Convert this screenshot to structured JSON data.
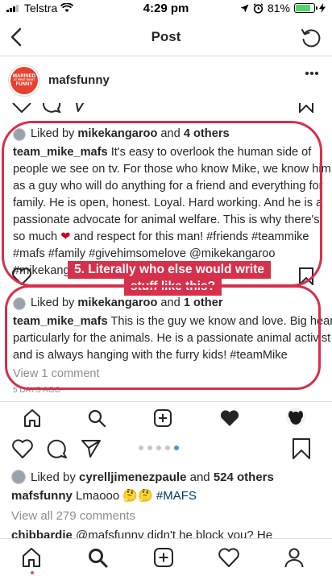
{
  "status_bar": {
    "carrier": "Telstra",
    "time": "4:29 pm",
    "battery": "81%",
    "battery_level": 0.81
  },
  "header": {
    "title": "Post"
  },
  "post": {
    "username": "mafsfunny",
    "logo_text": [
      "MARRIED",
      "AT FIRST SIGHT",
      "FUNNY"
    ]
  },
  "embedded": {
    "first_likes": {
      "prefix": "Liked by ",
      "user": "mikekangaroo",
      "mid": " and ",
      "others": "4 others"
    },
    "first_comment_lines": [
      {
        "user": "team_mike_mafs",
        "text": " It's easy to overlook the human side of"
      },
      {
        "text": "people we see on tv. For those who know Mike, we know him"
      },
      {
        "text": "as a guy who will do anything for a friend and everything for"
      },
      {
        "text": "family. He is open, honest. Loyal. Hard working. And he is a"
      },
      {
        "text": "passionate advocate for animal welfare. This is why there's"
      },
      {
        "pre": "so much ",
        "heart": "❤",
        "post": " and respect for this man! #friends #teammike"
      },
      {
        "text": "#mafs #family #givehimsomelove @mikekangaroo"
      },
      {
        "text": "#mikekangaroo"
      }
    ],
    "callout": [
      "5. Literally who else would write",
      "stuff like this?"
    ],
    "second_likes": {
      "prefix": "Liked by ",
      "user": "mikekangaroo",
      "mid": " and ",
      "others": "1 other"
    },
    "second_comment_lines": [
      {
        "user": "team_mike_mafs",
        "text": " This is the guy we know and love. Big heart,"
      },
      {
        "text": "particularly for the animals. He is a passionate animal activist"
      },
      {
        "text": "and is always hanging with the furry kids! #teamMike"
      }
    ],
    "view_comment": "View 1 comment",
    "age": "5 DAYS AGO"
  },
  "likes": {
    "prefix": "Liked by ",
    "user": "cyrelljimenezpaule",
    "mid": " and ",
    "others": "524 others"
  },
  "caption": {
    "user": "mafsfunny",
    "text": " Lmaooo ",
    "emoji": "🤔🤔",
    "tag": " #MAFS"
  },
  "view_all": "View all 279 comments",
  "next_comment": {
    "user": "chibbardie",
    "text": " @mafsfunny didn't he block you? He"
  },
  "carousel": {
    "count": 5,
    "active_index": 4
  },
  "colors": {
    "accent": "#3897f0",
    "highlight": "#d6304a",
    "heart": "#d0021b"
  }
}
